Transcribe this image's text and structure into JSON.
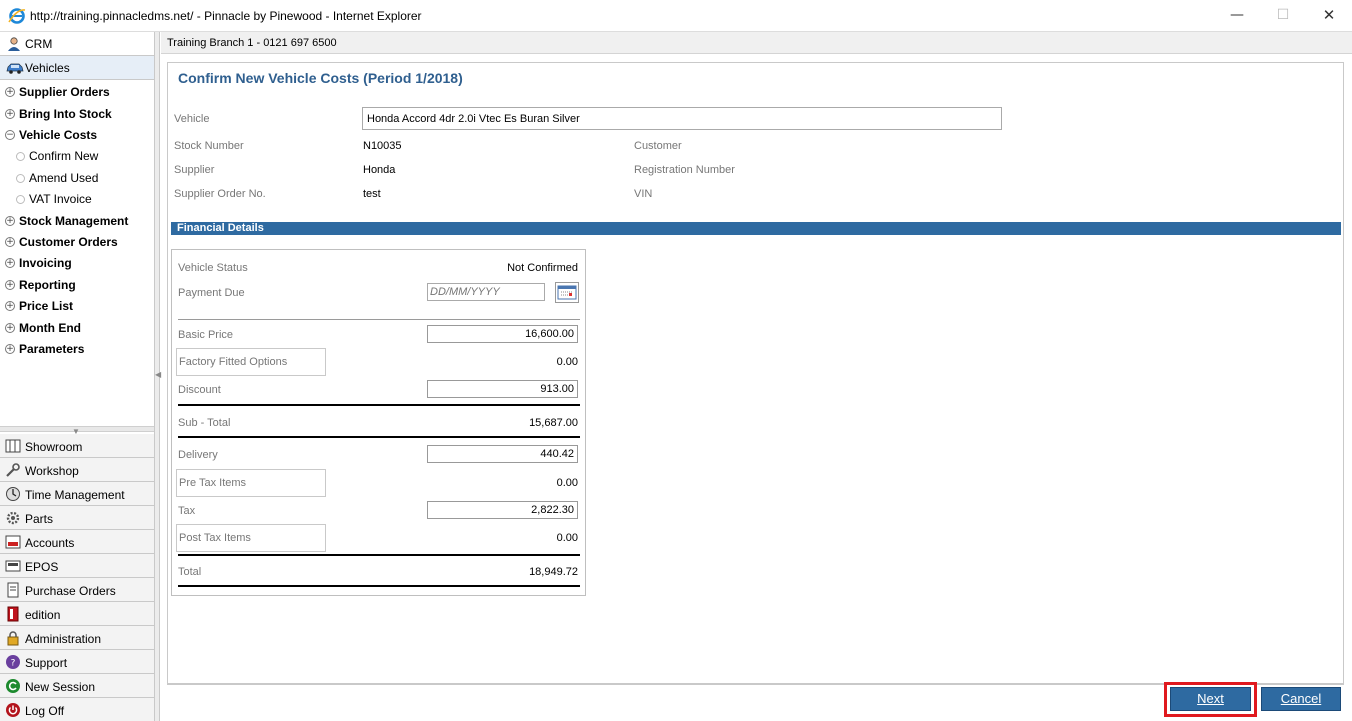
{
  "window": {
    "title": "http://training.pinnacledms.net/ - Pinnacle by Pinewood - Internet Explorer",
    "minimize": "—",
    "maximize": "☐",
    "close": "✕"
  },
  "sidebar": {
    "top": [
      {
        "label": "CRM",
        "icon": "person-icon"
      },
      {
        "label": "Vehicles",
        "icon": "car-icon"
      }
    ],
    "tree": [
      {
        "label": "Supplier Orders",
        "type": "node"
      },
      {
        "label": "Bring Into Stock",
        "type": "node"
      },
      {
        "label": "Vehicle Costs",
        "type": "node-open"
      },
      {
        "label": "Confirm New",
        "type": "leaf"
      },
      {
        "label": "Amend Used",
        "type": "leaf"
      },
      {
        "label": "VAT Invoice",
        "type": "leaf"
      },
      {
        "label": "Stock Management",
        "type": "node"
      },
      {
        "label": "Customer Orders",
        "type": "node"
      },
      {
        "label": "Invoicing",
        "type": "node"
      },
      {
        "label": "Reporting",
        "type": "node"
      },
      {
        "label": "Price List",
        "type": "node"
      },
      {
        "label": "Month End",
        "type": "node"
      },
      {
        "label": "Parameters",
        "type": "node"
      }
    ],
    "modules": [
      {
        "label": "Showroom",
        "icon": "showroom-icon"
      },
      {
        "label": "Workshop",
        "icon": "wrench-icon"
      },
      {
        "label": "Time Management",
        "icon": "clock-icon"
      },
      {
        "label": "Parts",
        "icon": "gear-icon"
      },
      {
        "label": "Accounts",
        "icon": "ledger-icon"
      },
      {
        "label": "EPOS",
        "icon": "till-icon"
      },
      {
        "label": "Purchase Orders",
        "icon": "document-icon"
      },
      {
        "label": "edition",
        "icon": "book-icon"
      },
      {
        "label": "Administration",
        "icon": "lock-icon"
      },
      {
        "label": "Support",
        "icon": "support-icon"
      },
      {
        "label": "New Session",
        "icon": "refresh-icon"
      },
      {
        "label": "Log Off",
        "icon": "power-icon"
      }
    ]
  },
  "branch": {
    "text": "Training Branch 1 - 0121 697 6500"
  },
  "page": {
    "title": "Confirm New Vehicle Costs (Period  1/2018)",
    "vehicle_label": "Vehicle",
    "vehicle_value": "Honda Accord 4dr 2.0i Vtec Es Buran Silver",
    "stock_number_label": "Stock Number",
    "stock_number_value": "N10035",
    "supplier_label": "Supplier",
    "supplier_value": "Honda",
    "supplier_order_label": "Supplier Order No.",
    "supplier_order_value": "test",
    "customer_label": "Customer",
    "registration_label": "Registration Number",
    "vin_label": "VIN"
  },
  "financial": {
    "header": "Financial Details",
    "vehicle_status_label": "Vehicle Status",
    "vehicle_status_value": "Not Confirmed",
    "payment_due_label": "Payment Due",
    "payment_due_placeholder": "DD/MM/YYYY",
    "basic_price_label": "Basic Price",
    "basic_price_value": "16,600.00",
    "factory_options_label": "Factory Fitted Options",
    "factory_options_value": "0.00",
    "discount_label": "Discount",
    "discount_value": "913.00",
    "subtotal_label": "Sub - Total",
    "subtotal_value": "15,687.00",
    "delivery_label": "Delivery",
    "delivery_value": "440.42",
    "pre_tax_label": "Pre Tax Items",
    "pre_tax_value": "0.00",
    "tax_label": "Tax",
    "tax_value": "2,822.30",
    "post_tax_label": "Post Tax Items",
    "post_tax_value": "0.00",
    "total_label": "Total",
    "total_value": "18,949.72"
  },
  "actions": {
    "next": "Next",
    "cancel": "Cancel"
  },
  "colors": {
    "accent": "#2e6aa1",
    "title": "#2f5f8f",
    "highlight": "#e0191e"
  }
}
